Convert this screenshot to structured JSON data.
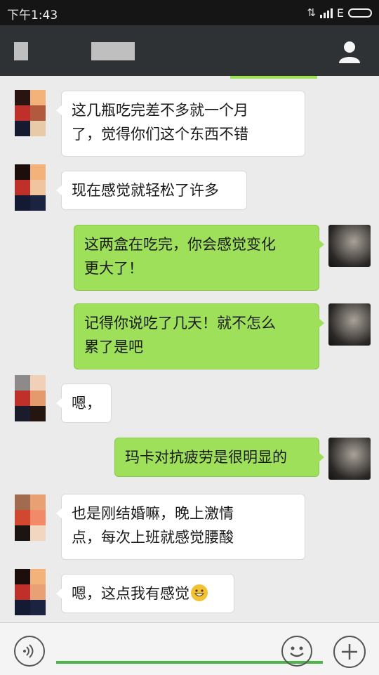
{
  "status_bar": {
    "time": "下午1:43",
    "network": "E"
  },
  "header": {
    "contact_name_blurred": true,
    "profile_icon": "person-icon"
  },
  "messages": [
    {
      "from": "contact",
      "lines": [
        "这几瓶吃完差不多就一个月",
        "了，觉得你们这个东西不错"
      ]
    },
    {
      "from": "contact",
      "lines": [
        "现在感觉就轻松了许多"
      ]
    },
    {
      "from": "me",
      "lines": [
        "这两盒在吃完，你会感觉变化",
        "更大了！"
      ]
    },
    {
      "from": "me",
      "lines": [
        "记得你说吃了几天！就不怎么",
        "累了是吧"
      ]
    },
    {
      "from": "contact",
      "lines": [
        "嗯，"
      ]
    },
    {
      "from": "me",
      "lines": [
        "玛卡对抗疲劳是很明显的"
      ]
    },
    {
      "from": "contact",
      "lines": [
        "也是刚结婚嘛，晚上激情",
        "点，每次上班就感觉腰酸"
      ]
    },
    {
      "from": "contact",
      "lines": [
        "嗯，这点我有感觉"
      ],
      "emoji": "grinning-face-emoji"
    }
  ],
  "input_bar": {
    "voice_icon": "voice-icon",
    "emoji_icon": "emoji-icon",
    "plus_icon": "plus-icon",
    "value": ""
  },
  "colors": {
    "outgoing_bubble": "#9ee05a",
    "incoming_bubble": "#ffffff",
    "titlebar": "#2f3235",
    "accent": "#4cb748"
  }
}
